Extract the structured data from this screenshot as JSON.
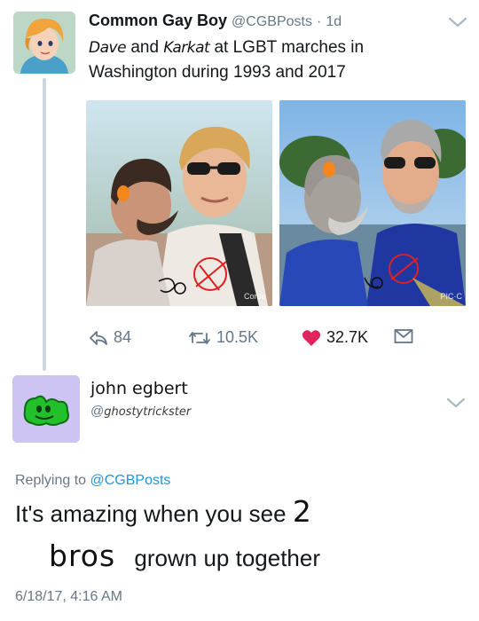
{
  "tweet": {
    "author_name": "Common Gay Boy",
    "handle": "@CGBPosts",
    "separator": "·",
    "time": "1d",
    "text_name1": "Dave",
    "text_and": "and",
    "text_name2": "Karkat",
    "text_rest_line1": "at LGBT marches in",
    "text_line2": "Washington during 1993 and 2017",
    "photos": [
      {
        "watermark": "Corde"
      },
      {
        "watermark": "PIC·C"
      }
    ],
    "actions": {
      "reply_count": "84",
      "retweet_count": "10.5K",
      "like_count": "32.7K"
    }
  },
  "reply": {
    "author_name": "john egbert",
    "handle_prefix": "@",
    "handle_name": "ghostytrickster",
    "replying_to_label": "Replying to",
    "replying_to_handle": "@CGBPosts",
    "text_part1": "It's amazing when you see",
    "text_handwritten_number": "2",
    "text_handwritten_word": "bros",
    "text_part2": "grown up together",
    "timestamp": "6/18/17, 4:16 AM"
  },
  "colors": {
    "link": "#1b95e0",
    "muted": "#657786",
    "like": "#e0245e",
    "thread_line": "#ccd6dd",
    "reply_avatar_bg": "#cdc4f4",
    "reply_avatar_icon": "#22c12b"
  },
  "icons": {
    "caret": "chevron-down-icon",
    "reply": "reply-icon",
    "retweet": "retweet-icon",
    "like": "heart-icon",
    "dm": "envelope-icon"
  }
}
